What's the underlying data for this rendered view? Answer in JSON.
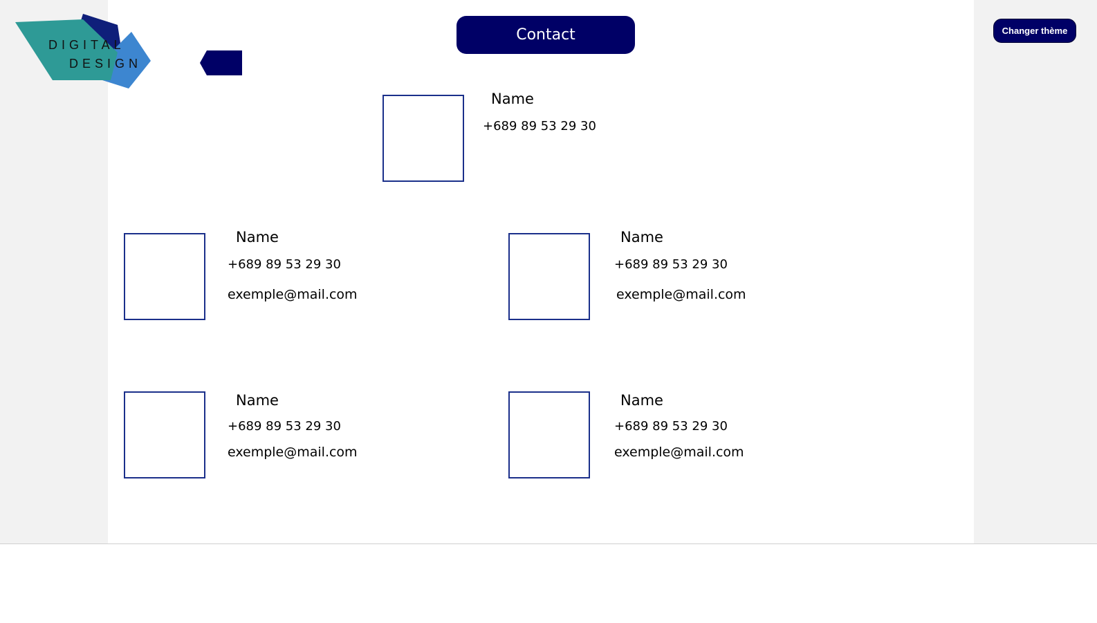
{
  "logo": {
    "line1": "DIGITAL",
    "line2": "DESIGN"
  },
  "header": {
    "title_button": "Contact",
    "back_icon": "back-arrow-icon"
  },
  "theme_button": {
    "label": "Changer thème"
  },
  "colors": {
    "accent": "#000066",
    "border": "#1a2f8a",
    "logo_teal": "#2e9a96",
    "logo_blue": "#3d86d0",
    "logo_navy": "#0f1f7a"
  },
  "contacts": [
    {
      "name": "Name",
      "phone": "+689 89 53 29 30"
    },
    {
      "name": "Name",
      "phone": "+689 89 53 29 30",
      "email": "exemple@mail.com"
    },
    {
      "name": "Name",
      "phone": "+689 89 53 29 30",
      "email": "exemple@mail.com"
    },
    {
      "name": "Name",
      "phone": "+689 89 53 29 30",
      "email": "exemple@mail.com"
    },
    {
      "name": "Name",
      "phone": "+689 89 53 29 30",
      "email": "exemple@mail.com"
    }
  ]
}
